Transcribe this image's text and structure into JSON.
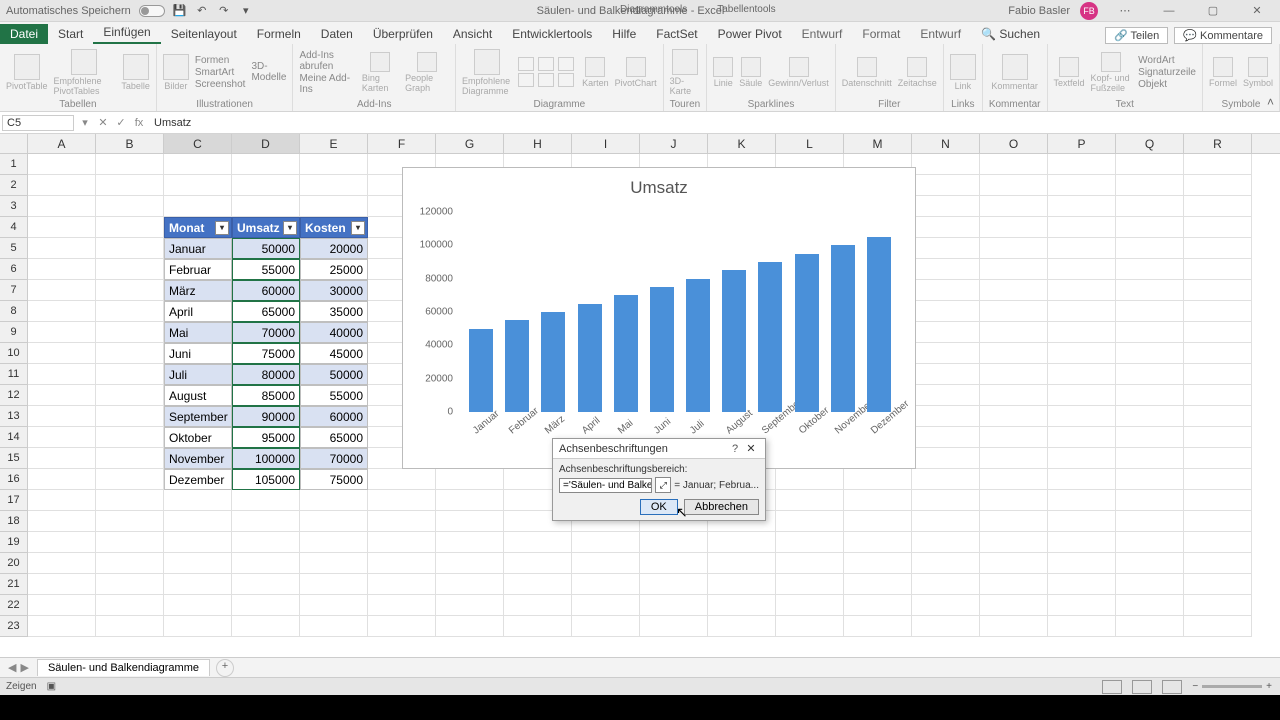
{
  "titlebar": {
    "autosave": "Automatisches Speichern",
    "docname": "Säulen- und Balkendiagramme - Excel",
    "tool1": "Diagrammtools",
    "tool2": "Tabellentools",
    "user": "Fabio Basler",
    "avatar": "FB"
  },
  "tabs": {
    "file": "Datei",
    "start": "Start",
    "einfugen": "Einfügen",
    "seiten": "Seitenlayout",
    "formeln": "Formeln",
    "daten": "Daten",
    "uberprufen": "Überprüfen",
    "ansicht": "Ansicht",
    "entwickler": "Entwicklertools",
    "hilfe": "Hilfe",
    "factset": "FactSet",
    "powerpivot": "Power Pivot",
    "entwurf": "Entwurf",
    "format": "Format",
    "entwurf2": "Entwurf",
    "search": "Suchen",
    "teilen": "Teilen",
    "kommentare": "Kommentare"
  },
  "ribbon_groups": {
    "tabellen": "Tabellen",
    "illustrationen": "Illustrationen",
    "addins": "Add-Ins",
    "diagramme": "Diagramme",
    "touren": "Touren",
    "sparklines": "Sparklines",
    "filter": "Filter",
    "links": "Links",
    "kommentar": "Kommentar",
    "text": "Text",
    "symbole": "Symbole"
  },
  "ribbon_items": {
    "pivottable": "PivotTable",
    "empf_pivot": "Empfohlene PivotTables",
    "tabelle": "Tabelle",
    "bilder": "Bilder",
    "formen": "Formen",
    "smartart": "SmartArt",
    "threed": "3D-Modelle",
    "screenshot": "Screenshot",
    "addins_abrufen": "Add-Ins abrufen",
    "meine_addins": "Meine Add-Ins",
    "bing": "Bing Karten",
    "people": "People Graph",
    "empf_diag": "Empfohlene Diagramme",
    "pivotchart": "PivotChart",
    "karte3d": "3D-Karte",
    "linie": "Linie",
    "saule": "Säule",
    "verlust": "Gewinn/Verlust",
    "datenschnitt": "Datenschnitt",
    "zeitachse": "Zeitachse",
    "link": "Link",
    "kommentar": "Kommentar",
    "textfeld": "Textfeld",
    "kopfzeile": "Kopf- und Fußzeile",
    "wordart": "WordArt",
    "signatur": "Signaturzeile",
    "objekt": "Objekt",
    "formel": "Formel",
    "symbol": "Symbol",
    "karten": "Karten"
  },
  "fbar": {
    "name": "C5",
    "formula": "Umsatz"
  },
  "columns": [
    "A",
    "B",
    "C",
    "D",
    "E",
    "F",
    "G",
    "H",
    "I",
    "J",
    "K",
    "L",
    "M",
    "N",
    "O",
    "P",
    "Q",
    "R"
  ],
  "table": {
    "headers": {
      "monat": "Monat",
      "umsatz": "Umsatz",
      "kosten": "Kosten"
    },
    "rows": [
      {
        "m": "Januar",
        "u": "50000",
        "k": "20000"
      },
      {
        "m": "Februar",
        "u": "55000",
        "k": "25000"
      },
      {
        "m": "März",
        "u": "60000",
        "k": "30000"
      },
      {
        "m": "April",
        "u": "65000",
        "k": "35000"
      },
      {
        "m": "Mai",
        "u": "70000",
        "k": "40000"
      },
      {
        "m": "Juni",
        "u": "75000",
        "k": "45000"
      },
      {
        "m": "Juli",
        "u": "80000",
        "k": "50000"
      },
      {
        "m": "August",
        "u": "85000",
        "k": "55000"
      },
      {
        "m": "September",
        "u": "90000",
        "k": "60000"
      },
      {
        "m": "Oktober",
        "u": "95000",
        "k": "65000"
      },
      {
        "m": "November",
        "u": "100000",
        "k": "70000"
      },
      {
        "m": "Dezember",
        "u": "105000",
        "k": "75000"
      }
    ]
  },
  "chart_data": {
    "type": "bar",
    "title": "Umsatz",
    "categories": [
      "Januar",
      "Februar",
      "März",
      "April",
      "Mai",
      "Juni",
      "Juli",
      "August",
      "September",
      "Oktober",
      "November",
      "Dezember"
    ],
    "values": [
      50000,
      55000,
      60000,
      65000,
      70000,
      75000,
      80000,
      85000,
      90000,
      95000,
      100000,
      105000
    ],
    "ylim": [
      0,
      120000
    ],
    "yticks": [
      0,
      20000,
      40000,
      60000,
      80000,
      100000,
      120000
    ],
    "xlabel": "",
    "ylabel": ""
  },
  "dialog": {
    "title": "Achsenbeschriftungen",
    "label": "Achsenbeschriftungsbereich:",
    "input": "='Säulen- und Balkendiagramme'",
    "preview": "= Januar; Februa...",
    "ok": "OK",
    "cancel": "Abbrechen"
  },
  "sheettabs": {
    "tab1": "Säulen- und Balkendiagramme"
  },
  "status": {
    "left": "Zeigen",
    "zoom": "+"
  }
}
